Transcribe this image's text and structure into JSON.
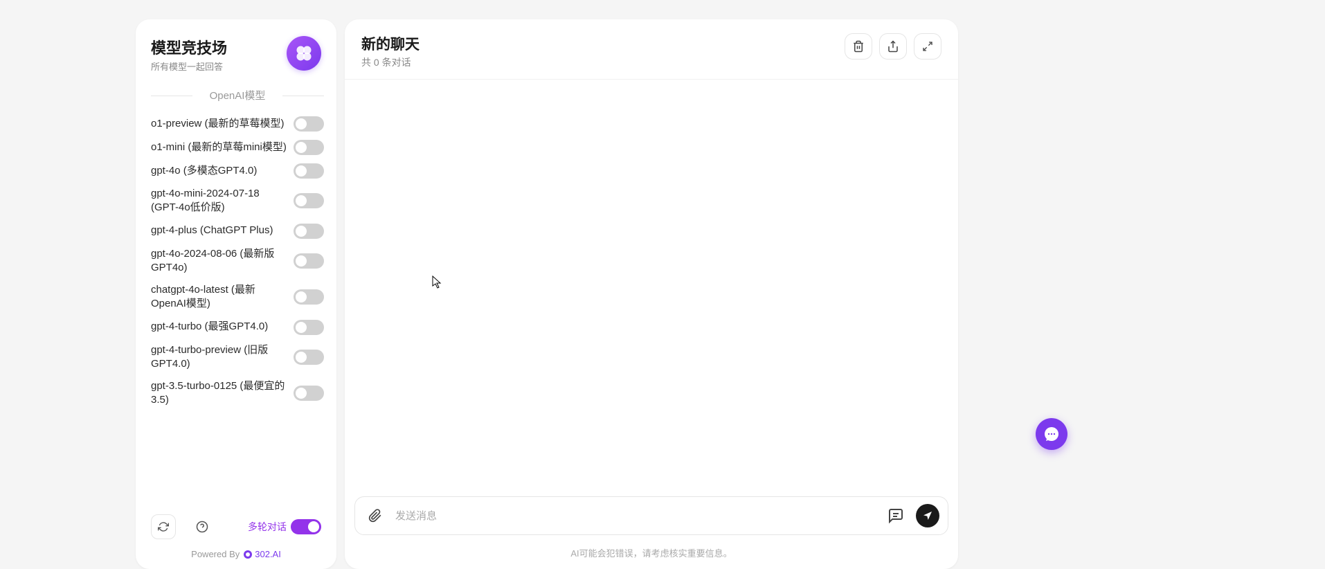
{
  "sidebar": {
    "title": "模型竞技场",
    "subtitle": "所有模型一起回答",
    "section_heading": "OpenAI模型",
    "models": [
      {
        "label": "o1-preview (最新的草莓模型)",
        "on": false
      },
      {
        "label": "o1-mini (最新的草莓mini模型)",
        "on": false
      },
      {
        "label": "gpt-4o (多模态GPT4.0)",
        "on": false
      },
      {
        "label": "gpt-4o-mini-2024-07-18 (GPT-4o低价版)",
        "on": false
      },
      {
        "label": "gpt-4-plus (ChatGPT Plus)",
        "on": false
      },
      {
        "label": "gpt-4o-2024-08-06 (最新版GPT4o)",
        "on": false
      },
      {
        "label": "chatgpt-4o-latest (最新OpenAI模型)",
        "on": false
      },
      {
        "label": "gpt-4-turbo (最强GPT4.0)",
        "on": false
      },
      {
        "label": "gpt-4-turbo-preview (旧版GPT4.0)",
        "on": false
      },
      {
        "label": "gpt-3.5-turbo-0125 (最便宜的3.5)",
        "on": false
      }
    ],
    "multi_turn_label": "多轮对话",
    "multi_turn_on": true,
    "powered_by_prefix": "Powered By",
    "powered_by_brand": "302.AI"
  },
  "main": {
    "title": "新的聊天",
    "subtitle": "共 0 条对话",
    "composer_placeholder": "发送消息",
    "disclaimer": "AI可能会犯错误，请考虑核实重要信息。"
  }
}
